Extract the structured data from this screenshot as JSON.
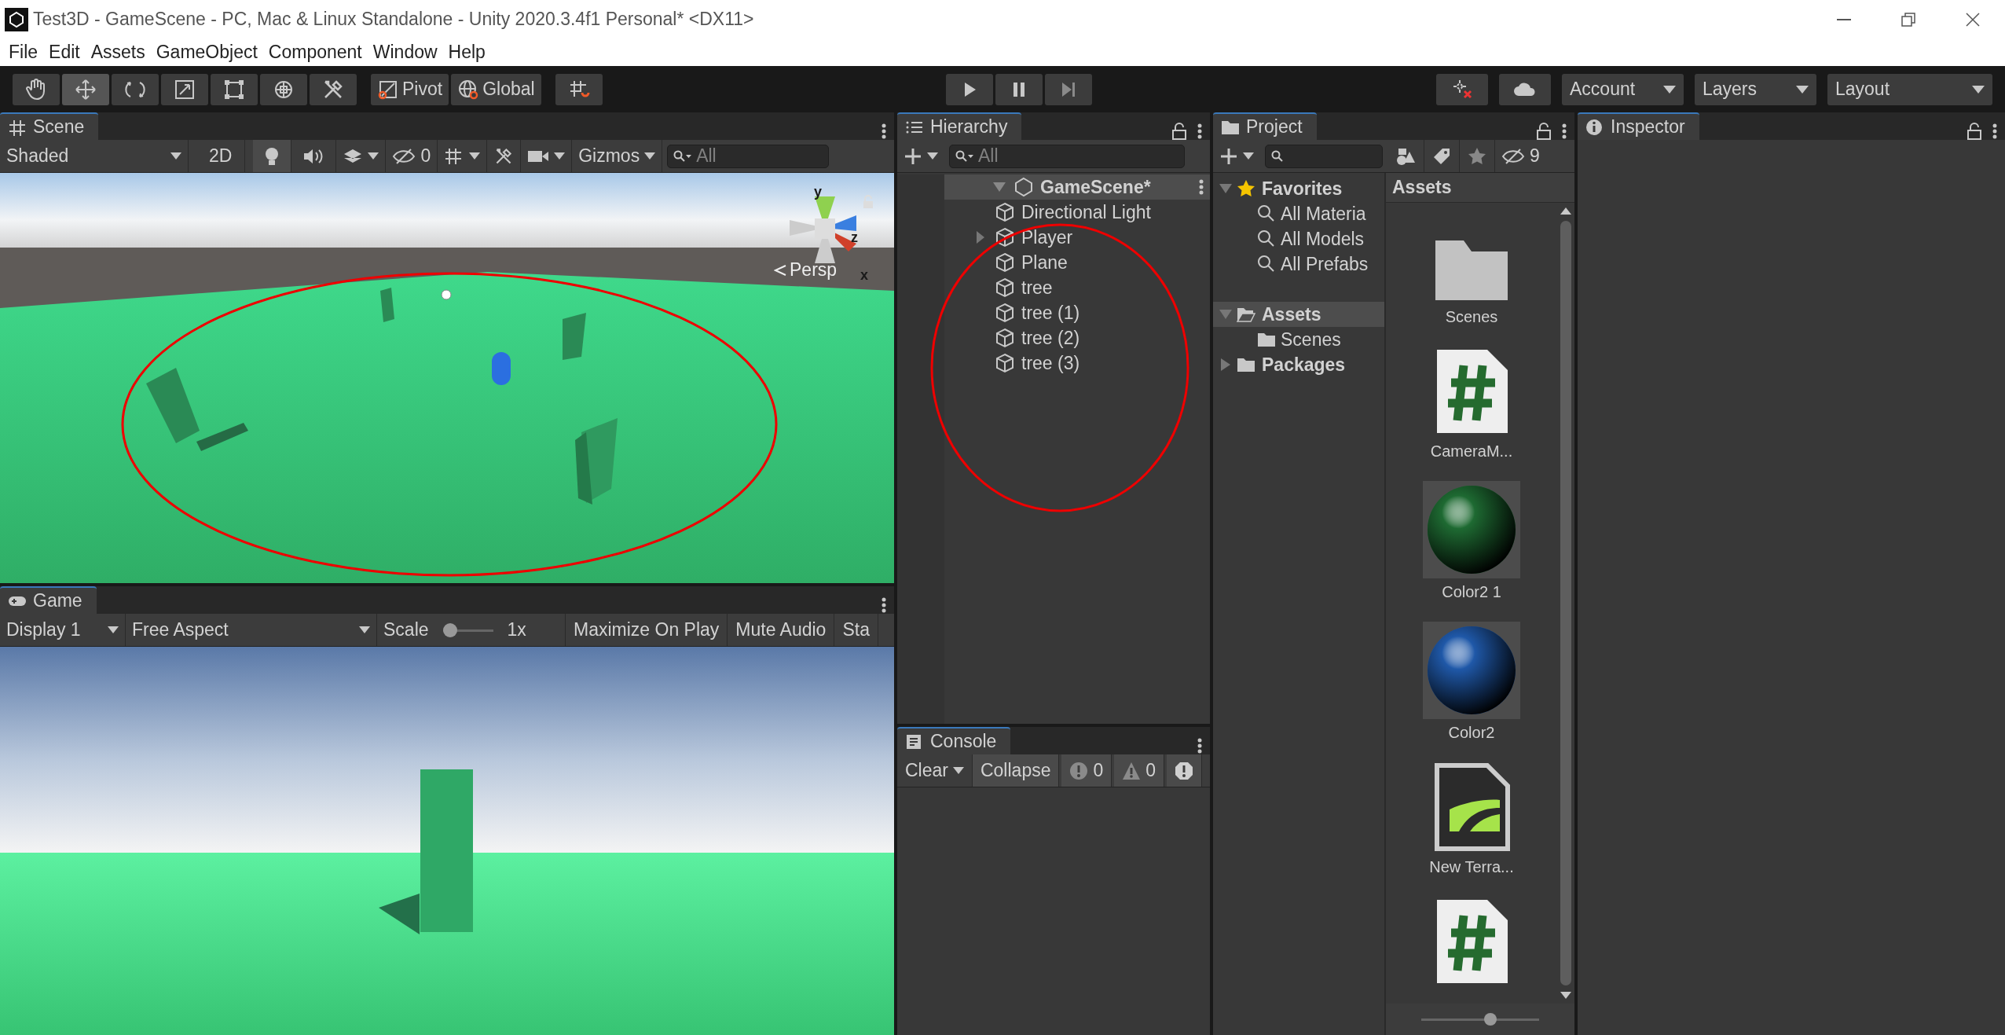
{
  "window": {
    "title": "Test3D - GameScene - PC, Mac & Linux Standalone - Unity 2020.3.4f1 Personal* <DX11>"
  },
  "menu": [
    "File",
    "Edit",
    "Assets",
    "GameObject",
    "Component",
    "Window",
    "Help"
  ],
  "toolbar": {
    "tools": [
      {
        "kind": "hand",
        "selected": false
      },
      {
        "kind": "move",
        "selected": true
      },
      {
        "kind": "rotate",
        "selected": false
      },
      {
        "kind": "scale",
        "selected": false
      },
      {
        "kind": "rect",
        "selected": false
      },
      {
        "kind": "transform",
        "selected": false
      },
      {
        "kind": "custom",
        "selected": false
      }
    ],
    "pivot": "Pivot",
    "global": "Global",
    "account": "Account",
    "layers": "Layers",
    "layout": "Layout"
  },
  "scene": {
    "tab": "Scene",
    "shading": "Shaded",
    "mode_2d": "2D",
    "hidden_count": "0",
    "gizmos": "Gizmos",
    "search_placeholder": "All",
    "projection": "Persp",
    "axes": [
      "y",
      "z",
      "x"
    ],
    "circled": true
  },
  "game": {
    "tab": "Game",
    "display": "Display 1",
    "aspect": "Free Aspect",
    "scale_label": "Scale",
    "scale": {
      "level": 0
    },
    "scale_value": "1x",
    "buttons": [
      "Maximize On Play",
      "Mute Audio",
      "Sta"
    ]
  },
  "hierarchy": {
    "tab": "Hierarchy",
    "search_placeholder": "All",
    "scene": "GameScene*",
    "circled": true,
    "objects": [
      {
        "name": "Directional Light",
        "has_children": false
      },
      {
        "name": "Player",
        "has_children": true
      },
      {
        "name": "Plane",
        "has_children": false
      },
      {
        "name": "tree",
        "has_children": false
      },
      {
        "name": "tree (1)",
        "has_children": false
      },
      {
        "name": "tree (2)",
        "has_children": false
      },
      {
        "name": "tree (3)",
        "has_children": false
      }
    ]
  },
  "console": {
    "tab": "Console",
    "clear": "Clear",
    "collapse": "Collapse",
    "counters": [
      {
        "kind": "info",
        "count": "0"
      },
      {
        "kind": "warning",
        "count": "0"
      },
      {
        "kind": "error"
      }
    ]
  },
  "project": {
    "tab": "Project",
    "hidden_count": "9",
    "tree": [
      {
        "name": "Favorites",
        "kind": "favorites",
        "expanded": true,
        "selected": false,
        "children": [
          {
            "name": "All Materia",
            "kind": "search"
          },
          {
            "name": "All Models",
            "kind": "search"
          },
          {
            "name": "All Prefabs",
            "kind": "search"
          }
        ]
      },
      {
        "name": "Assets",
        "kind": "folder",
        "expanded": true,
        "selected": true,
        "children": [
          {
            "name": "Scenes",
            "kind": "folder"
          }
        ]
      },
      {
        "name": "Packages",
        "kind": "folder",
        "expanded": false,
        "selected": false
      }
    ],
    "grid_title": "Assets",
    "icon_size": {
      "level": 0.6
    },
    "items": [
      {
        "kind": "folder",
        "label": "Scenes"
      },
      {
        "kind": "script",
        "label": "CameraM..."
      },
      {
        "kind": "material",
        "label": "Color2 1",
        "color": "#1e6a32"
      },
      {
        "kind": "material",
        "label": "Color2",
        "color": "#1f58a8"
      },
      {
        "kind": "terrain",
        "label": "New Terra..."
      },
      {
        "kind": "script"
      }
    ]
  },
  "inspector": {
    "tab": "Inspector"
  }
}
